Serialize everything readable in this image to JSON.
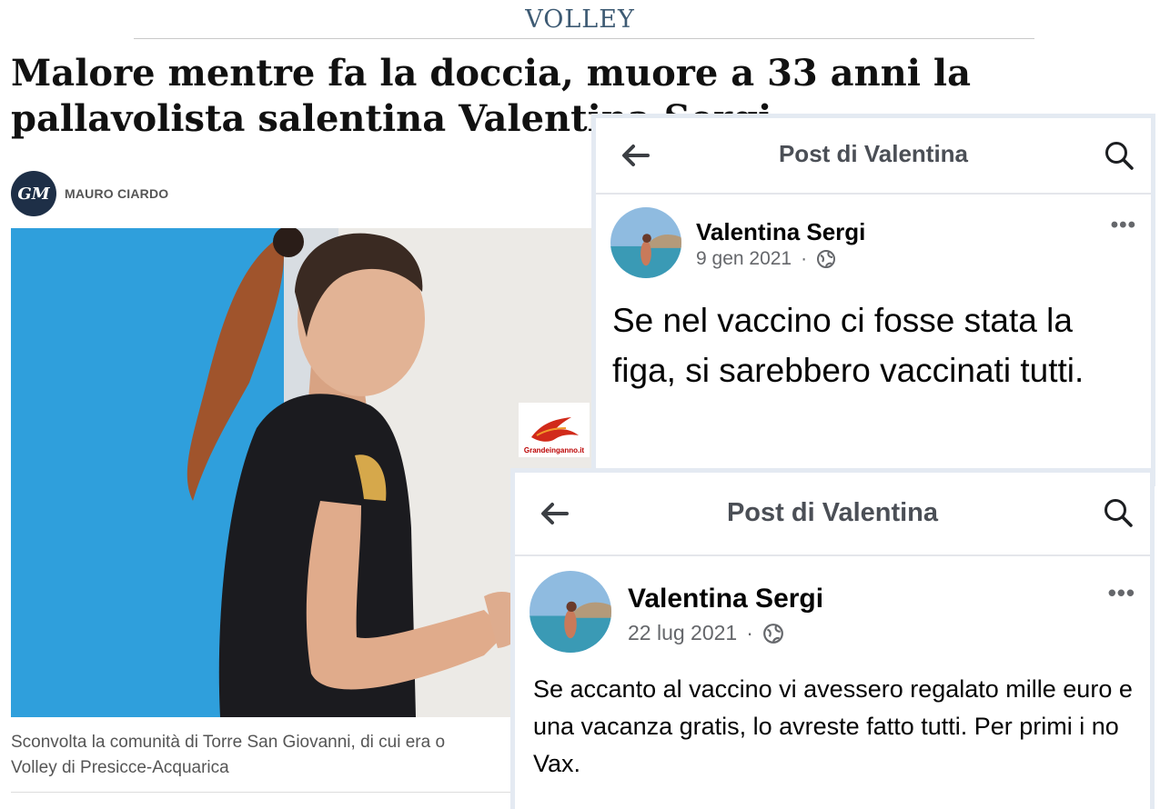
{
  "article": {
    "section": "VOLLEY",
    "headline": "Malore mentre fa la doccia, muore a 33 anni la pallavolista salentina Valentina Sergi",
    "author_initials": "GM",
    "author": "MAURO CIARDO",
    "caption_line1": "Sconvolta la comunità di Torre San Giovanni, di cui era o",
    "caption_line2": "Volley di Presicce-Acquarica",
    "watermark": "Grandeinganno.it"
  },
  "posts": [
    {
      "header_title": "Post di Valentina",
      "name": "Valentina Sergi",
      "date": "9 gen 2021",
      "separator": "·",
      "more": "•••",
      "text": "Se nel vaccino ci fosse stata la figa, si sarebbero vaccinati tutti."
    },
    {
      "header_title": "Post di Valentina",
      "name": "Valentina Sergi",
      "date": "22 lug 2021",
      "separator": "·",
      "more": "•••",
      "text": "Se accanto al vaccino vi avessero regalato mille euro e una vacanza gratis, lo avreste fatto tutti. Per primi i no Vax."
    }
  ],
  "colors": {
    "section_label": "#3d5a73",
    "author_avatar_bg": "#1e2f47",
    "fb_border": "#e4eaf2",
    "fb_secondary_text": "#65676b",
    "photo_blue_background": "#2f9fdc"
  },
  "icons": [
    "back-arrow-icon",
    "search-icon",
    "globe-icon",
    "more-options-icon",
    "phoenix-logo-icon"
  ]
}
